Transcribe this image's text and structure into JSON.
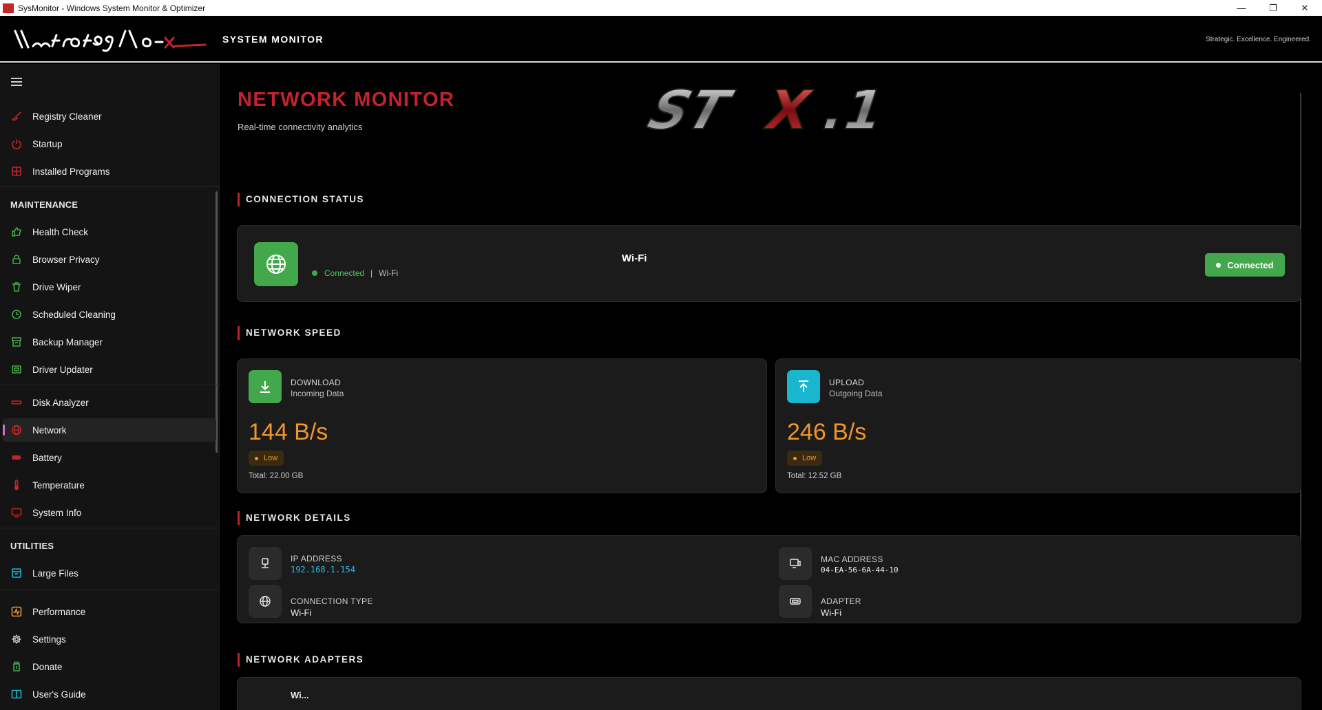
{
  "window": {
    "title": "SysMonitor - Windows System Monitor & Optimizer",
    "controls": {
      "minimize": "—",
      "restore": "❐",
      "close": "✕"
    }
  },
  "header": {
    "system_title": "SYSTEM MONITOR",
    "tagline": "Strategic. Excellence. Engineered."
  },
  "sidebar": {
    "group1": [
      {
        "label": "Registry Cleaner",
        "icon": "broom-icon"
      },
      {
        "label": "Startup",
        "icon": "power-icon"
      },
      {
        "label": "Installed Programs",
        "icon": "grid-box-icon"
      }
    ],
    "maintenance_header": "MAINTENANCE",
    "maintenance": [
      {
        "label": "Health Check",
        "icon": "thumbs-up-icon"
      },
      {
        "label": "Browser Privacy",
        "icon": "lock-icon"
      },
      {
        "label": "Drive Wiper",
        "icon": "trash-icon"
      },
      {
        "label": "Scheduled Cleaning",
        "icon": "clock-icon"
      },
      {
        "label": "Backup Manager",
        "icon": "archive-icon"
      },
      {
        "label": "Driver Updater",
        "icon": "chip-icon"
      }
    ],
    "group3": [
      {
        "label": "Disk Analyzer",
        "icon": "disk-icon"
      },
      {
        "label": "Network",
        "icon": "globe-icon",
        "active": true
      },
      {
        "label": "Battery",
        "icon": "battery-icon"
      },
      {
        "label": "Temperature",
        "icon": "thermometer-icon"
      },
      {
        "label": "System Info",
        "icon": "monitor-icon"
      }
    ],
    "utilities_header": "UTILITIES",
    "utilities": [
      {
        "label": "Large Files",
        "icon": "box-icon"
      }
    ],
    "group5": [
      {
        "label": "Performance",
        "icon": "pulse-icon"
      },
      {
        "label": "Settings",
        "icon": "gear-icon"
      },
      {
        "label": "Donate",
        "icon": "jar-icon"
      },
      {
        "label": "User's Guide",
        "icon": "book-icon"
      }
    ]
  },
  "main": {
    "title": "NETWORK MONITOR",
    "subtitle": "Real-time connectivity analytics",
    "logo_text": "STX.1",
    "sections": {
      "connection_status": "CONNECTION STATUS",
      "network_speed": "NETWORK SPEED",
      "network_details": "NETWORK DETAILS",
      "network_adapters": "NETWORK ADAPTERS"
    },
    "connection": {
      "name": "Wi-Fi",
      "status": "Connected",
      "separator": "|",
      "type": "Wi-Fi",
      "badge": "Connected"
    },
    "download": {
      "label": "DOWNLOAD",
      "sub": "Incoming Data",
      "value": "144 B/s",
      "level": "Low",
      "total": "Total: 22.00 GB"
    },
    "upload": {
      "label": "UPLOAD",
      "sub": "Outgoing Data",
      "value": "246 B/s",
      "level": "Low",
      "total": "Total: 12.52 GB"
    },
    "details": {
      "ip_label": "IP ADDRESS",
      "ip_value": "192.168.1.154",
      "mac_label": "MAC ADDRESS",
      "mac_value": "04-EA-56-6A-44-10",
      "conn_type_label": "CONNECTION TYPE",
      "conn_type_value": "Wi-Fi",
      "adapter_label": "ADAPTER",
      "adapter_value": "Wi-Fi"
    },
    "adapter_partial": "Wi..."
  },
  "colors": {
    "accent_red": "#c3232b",
    "green": "#43a84b",
    "cyan": "#1ab6cf",
    "orange": "#f0962c",
    "ip_blue": "#35b6e0"
  }
}
